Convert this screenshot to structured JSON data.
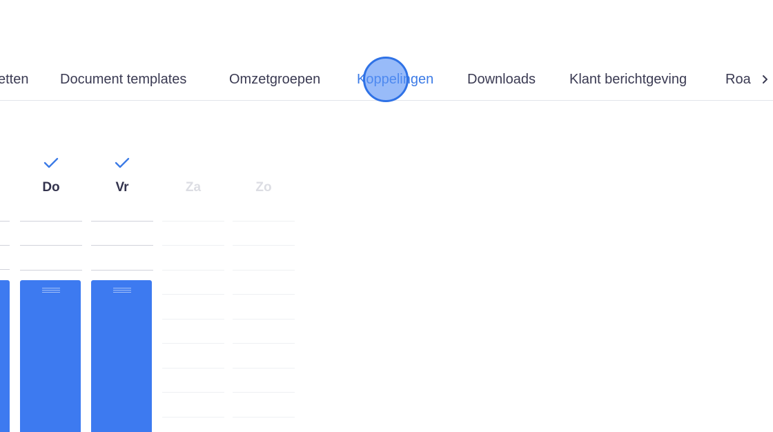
{
  "tabs": [
    {
      "label": "etten",
      "active": false
    },
    {
      "label": "Document templates",
      "active": false
    },
    {
      "label": "Omzetgroepen",
      "active": false
    },
    {
      "label": "Koppelingen",
      "active": true
    },
    {
      "label": "Downloads",
      "active": false
    },
    {
      "label": "Klant berichtgeving",
      "active": false
    },
    {
      "label": "Roa",
      "active": false
    }
  ],
  "scroll_right_icon": "chevron-right-icon",
  "schedule": {
    "days": [
      {
        "label": "Do",
        "checked": true,
        "enabled": true,
        "has_block": true
      },
      {
        "label": "Vr",
        "checked": true,
        "enabled": true,
        "has_block": true
      },
      {
        "label": "Za",
        "checked": false,
        "enabled": false,
        "has_block": false
      },
      {
        "label": "Zo",
        "checked": false,
        "enabled": false,
        "has_block": false
      }
    ]
  },
  "colors": {
    "accent": "#3c7be6",
    "block": "#3d7af0",
    "text": "#3a3a52",
    "disabled_text": "#dcdde3"
  }
}
